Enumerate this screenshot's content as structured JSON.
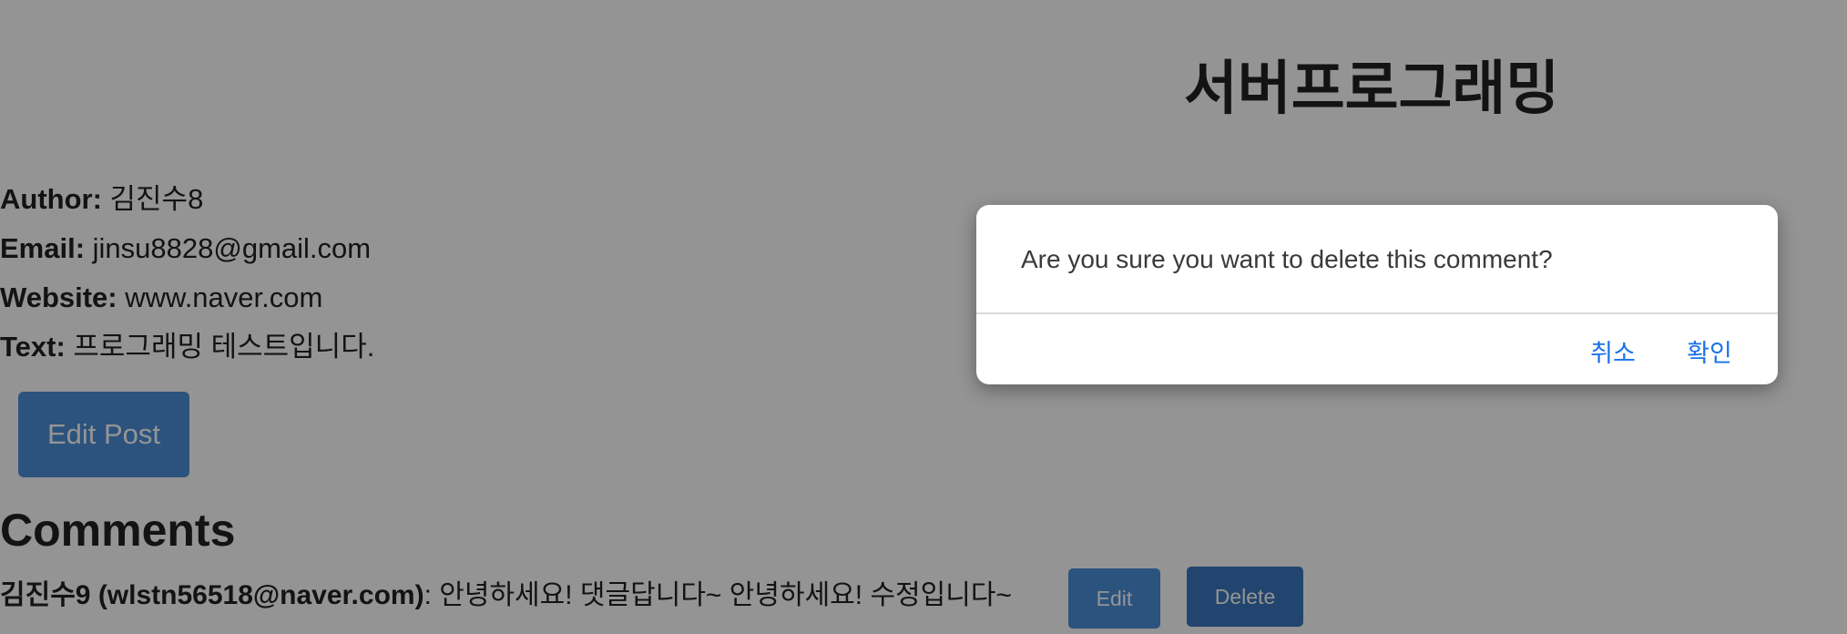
{
  "post": {
    "title": "서버프로그래밍",
    "author_label": "Author:",
    "author_value": " 김진수8",
    "email_label": "Email:",
    "email_value": " jinsu8828@gmail.com",
    "website_label": "Website:",
    "website_value": " www.naver.com",
    "text_label": "Text:",
    "text_value": " 프로그래밍 테스트입니다.",
    "edit_button": "Edit Post"
  },
  "comments": {
    "heading": "Comments",
    "items": [
      {
        "author": "김진수9 (wlstn56518@naver.com)",
        "text": ": 안녕하세요! 댓글답니다~ 안녕하세요! 수정입니다~",
        "edit_label": "Edit",
        "delete_label": "Delete"
      }
    ]
  },
  "dialog": {
    "message": "Are you sure you want to delete this comment?",
    "cancel_label": "취소",
    "confirm_label": "확인"
  },
  "colors": {
    "overlay": "rgba(0,0,0,0.42)",
    "primary_button": "#4a90d9",
    "dialog_link": "#1a73e8"
  }
}
